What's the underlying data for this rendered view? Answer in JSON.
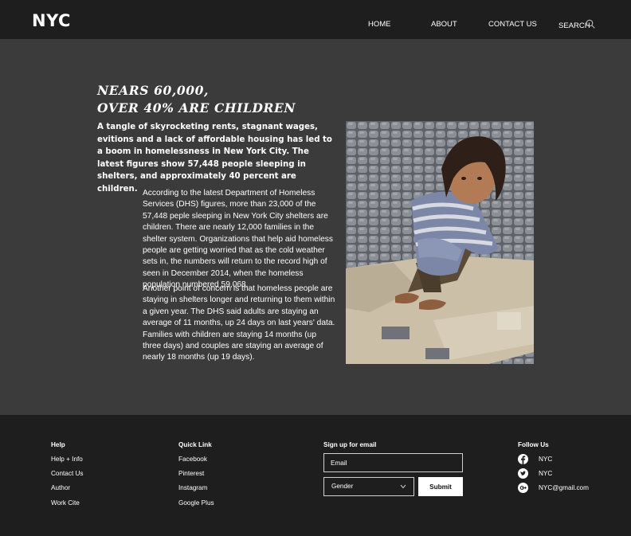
{
  "header": {
    "logo": "NYC",
    "nav": {
      "home": "HOME",
      "about": "ABOUT",
      "contact": "CONTACT US",
      "search": "SEARCH"
    }
  },
  "article": {
    "headline_line1": "Nears 60,000,",
    "headline_line2": "over 40% are children",
    "lead": "A tangle of skyrocketing rents, stagnant wages, evitions and a lack of affordable housing has led to a boom in homelessness in New York City. The latest figures show 57,448 people sleeping in shelters, and approximately 40 percent are children.",
    "paragraph1": "According to the latest Department of Homeless Services (DHS) figures, more than 23,000 of the 57,448 peple sleeping in New York City shelters are children. There are nearly 12,000 families in the shelter system. Organizations that help aid homeless people are getting worried that as the cold weather sets in, the numbers will return to the record high of seen in December 2014, when the homeless population numbered 59,068.",
    "paragraph2": "Another point of concern is that homeless people are staying in shelters longer and returning to them within a given year. The DHS said adults are staying an average of 11 months, up 24 days on last years' data. Families with children are staying 14 months (up three days) and couples are staying an average of nearly 18 months (up 19 days)."
  },
  "footer": {
    "help": {
      "heading": "Help",
      "links": [
        "Help + Info",
        "Contact Us",
        "Author",
        "Work Cite"
      ]
    },
    "quick_link": {
      "heading": "Quick Link",
      "links": [
        "Facebook",
        "Pinterest",
        "Instagram",
        "Google Plus"
      ]
    },
    "signup": {
      "heading": "Sign up for email",
      "email_placeholder": "Email",
      "gender_label": "Gender",
      "submit_label": "Submit"
    },
    "follow": {
      "heading": "Follow Us",
      "items": [
        {
          "icon": "facebook-icon",
          "text": "NYC"
        },
        {
          "icon": "twitter-icon",
          "text": "NYC"
        },
        {
          "icon": "google-plus-icon",
          "text": "NYC@gmail.com"
        }
      ]
    }
  },
  "colors": {
    "page_bg": "#3b3b3b",
    "header_footer_bg": "#1f1e1f",
    "text": "#ffffff"
  }
}
